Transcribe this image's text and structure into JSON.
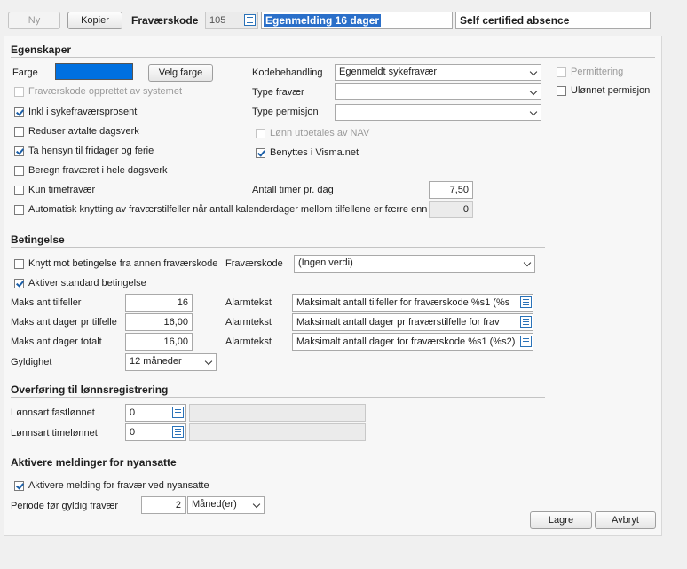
{
  "toolbar": {
    "new_label": "Ny",
    "copy_label": "Kopier",
    "code_label": "Fraværskode",
    "code_value": "105",
    "name_value": "Egenmelding 16 dager",
    "english_name_value": "Self certified absence"
  },
  "properties": {
    "title": "Egenskaper",
    "color_label": "Farge",
    "color_value": "#0070e0",
    "choose_color_label": "Velg farge",
    "code_handling_label": "Kodebehandling",
    "code_handling_value": "Egenmeldt sykefravær",
    "absence_type_label": "Type fravær",
    "absence_type_value": "",
    "leave_type_label": "Type permisjon",
    "leave_type_value": "",
    "permitting_label": "Permittering",
    "unpaid_leave_label": "Ulønnet permisjon",
    "system_created_label": "Fraværskode opprettet av systemet",
    "include_sick_pct_label": "Inkl i sykefraværsprosent",
    "reduce_workdays_label": "Reduser avtalte dagsverk",
    "holidays_label": "Ta hensyn til fridager og ferie",
    "full_day_label": "Beregn fraværet i hele dagsverk",
    "nav_salary_label": "Lønn utbetales av NAV",
    "visma_label": "Benyttes i Visma.net",
    "hour_only_label": "Kun timefravær",
    "hours_per_day_label": "Antall timer pr. dag",
    "hours_per_day_value": "7,50",
    "auto_link_label": "Automatisk knytting av fraværstilfeller når antall kalenderdager mellom tilfellene er færre enn",
    "auto_link_value": "0"
  },
  "conditions": {
    "title": "Betingelse",
    "link_condition_label": "Knytt mot betingelse fra annen fraværskode",
    "absence_code_label": "Fraværskode",
    "absence_code_value": "(Ingen verdi)",
    "standard_condition_label": "Aktiver standard betingelse",
    "max_cases_label": "Maks ant tilfeller",
    "max_cases_value": "16",
    "max_days_case_label": "Maks ant dager pr tilfelle",
    "max_days_case_value": "16,00",
    "max_days_total_label": "Maks ant dager totalt",
    "max_days_total_value": "16,00",
    "alarm_label": "Alarmtekst",
    "alarm1_value": "Maksimalt antall tilfeller for fraværskode %s1 (%s",
    "alarm2_value": "Maksimalt antall dager pr fraværstilfelle for frav",
    "alarm3_value": "Maksimalt antall dager for fraværskode %s1 (%s2)",
    "validity_label": "Gyldighet",
    "validity_value": "12 måneder"
  },
  "transfer": {
    "title": "Overføring til lønnsregistrering",
    "fixed_label": "Lønnsart fastlønnet",
    "fixed_value": "0",
    "hourly_label": "Lønnsart timelønnet",
    "hourly_value": "0"
  },
  "messages": {
    "title": "Aktivere meldinger for nyansatte",
    "activate_label": "Aktivere melding for fravær ved nyansatte",
    "period_label": "Periode før gyldig fravær",
    "period_value": "2",
    "period_unit": "Måned(er)"
  },
  "footer": {
    "save_label": "Lagre",
    "cancel_label": "Avbryt"
  }
}
